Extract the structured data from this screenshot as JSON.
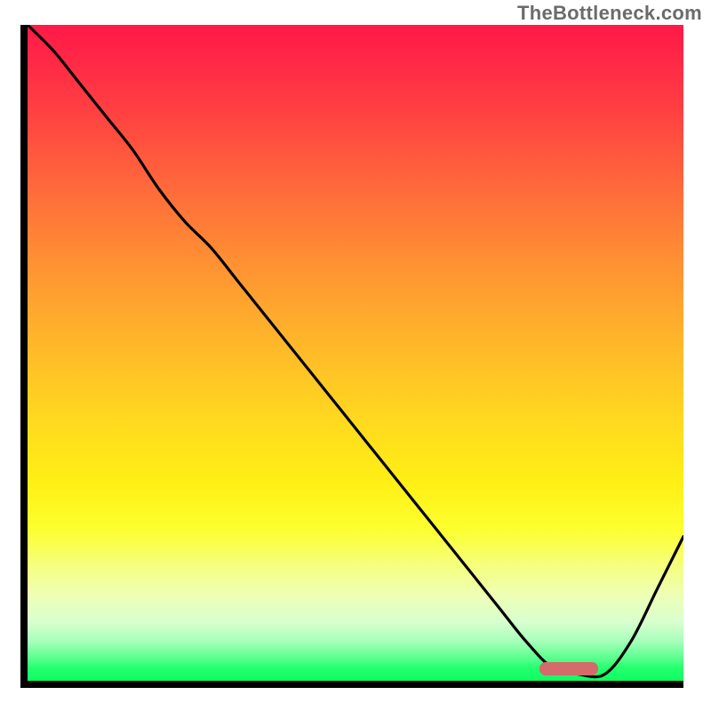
{
  "attribution": "TheBottleneck.com",
  "colors": {
    "gradient_top": "#ff1948",
    "gradient_mid": "#ffd81f",
    "gradient_bottom": "#0aff60",
    "curve": "#000000",
    "marker": "#d46a6a",
    "axis": "#000000"
  },
  "chart_data": {
    "type": "line",
    "title": "",
    "xlabel": "",
    "ylabel": "",
    "xlim": [
      0,
      100
    ],
    "ylim": [
      0,
      100
    ],
    "grid": false,
    "legend": false,
    "x": [
      0,
      4,
      8,
      12,
      16,
      20,
      24,
      28,
      32,
      36,
      40,
      44,
      48,
      52,
      56,
      60,
      64,
      68,
      72,
      76,
      80,
      84,
      88,
      92,
      96,
      100
    ],
    "values": [
      100,
      96,
      91,
      86,
      81,
      75,
      70,
      66,
      61,
      56,
      51,
      46,
      41,
      36,
      31,
      26,
      21,
      16,
      11,
      6,
      2,
      1,
      1,
      6,
      14,
      22
    ],
    "marker_segment": {
      "x_start": 78,
      "x_end": 87,
      "y": 1.8,
      "thickness_pct": 2.0
    },
    "annotations": []
  }
}
